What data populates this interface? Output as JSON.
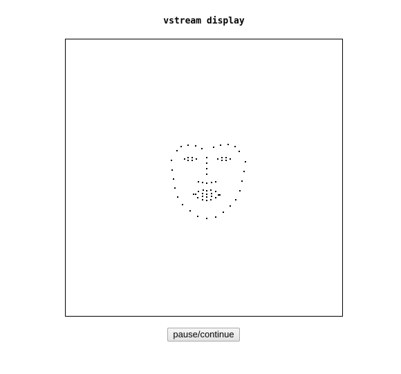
{
  "page": {
    "title": "vstream display"
  },
  "controls": {
    "pause_label": "pause/continue"
  },
  "display": {
    "point_color": "#000000",
    "content": "face-landmark-points"
  }
}
